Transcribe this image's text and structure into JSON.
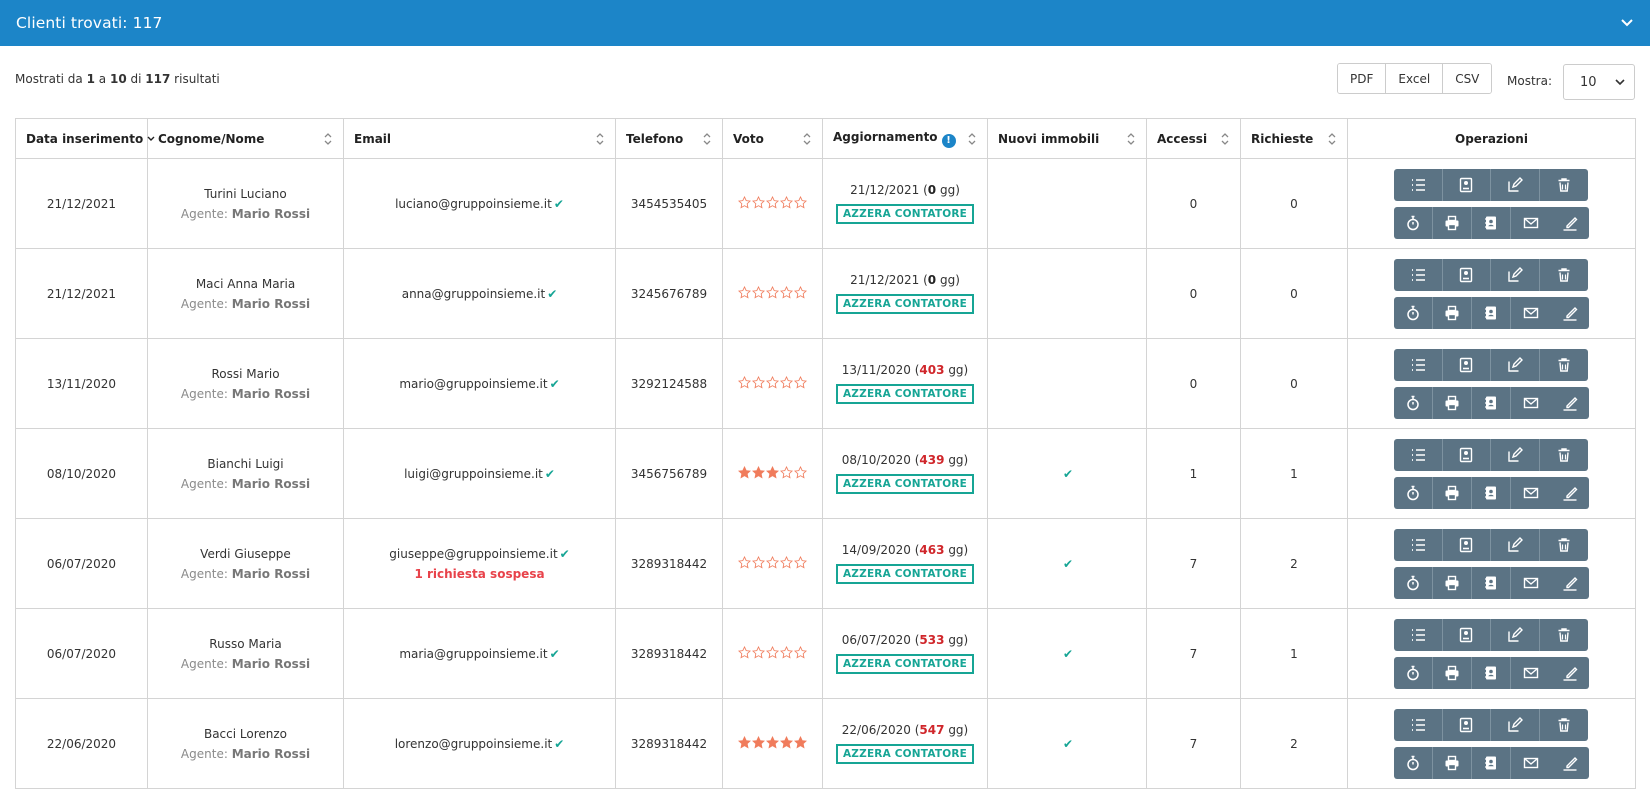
{
  "header": {
    "title": "Clienti trovati: 117"
  },
  "summary": {
    "prefix": "Mostrati da",
    "from": "1",
    "a": "a",
    "to": "10",
    "di": "di",
    "total": "117",
    "suffix": "risultati"
  },
  "exports": [
    "PDF",
    "Excel",
    "CSV"
  ],
  "mostra": {
    "label": "Mostra:",
    "value": "10"
  },
  "columns": [
    "Data inserimento",
    "Cognome/Nome",
    "Email",
    "Telefono",
    "Voto",
    "Aggiornamento",
    "Nuovi immobili",
    "Accessi",
    "Richieste",
    "Operazioni"
  ],
  "agent_label": "Agente:",
  "reset_label": "AZZERA CONTATORE",
  "days_suffix": "gg)",
  "icons": {
    "ops_row1": [
      "list-icon",
      "profile-card-icon",
      "edit-icon",
      "trash-icon"
    ],
    "ops_row2": [
      "stopwatch-icon",
      "print-icon",
      "address-book-icon",
      "mail-icon",
      "signature-icon"
    ]
  },
  "colors": {
    "header_blue": "#1c85c8",
    "teal": "#16a595",
    "star": "#f07c5c",
    "days_red": "#d0262b",
    "button": "#5b7384"
  },
  "rows": [
    {
      "date": "21/12/2021",
      "name": "Turini Luciano",
      "agent": "Mario Rossi",
      "email": "luciano@gruppoinsieme.it",
      "pending": "",
      "phone": "3454535405",
      "rating": 0,
      "upd_date": "21/12/2021 (",
      "upd_days": "0",
      "new_properties": false,
      "accessi": "0",
      "richieste": "0"
    },
    {
      "date": "21/12/2021",
      "name": "Maci Anna Maria",
      "agent": "Mario Rossi",
      "email": "anna@gruppoinsieme.it",
      "pending": "",
      "phone": "3245676789",
      "rating": 0,
      "upd_date": "21/12/2021 (",
      "upd_days": "0",
      "new_properties": false,
      "accessi": "0",
      "richieste": "0"
    },
    {
      "date": "13/11/2020",
      "name": "Rossi Mario",
      "agent": "Mario Rossi",
      "email": "mario@gruppoinsieme.it",
      "pending": "",
      "phone": "3292124588",
      "rating": 0,
      "upd_date": "13/11/2020 (",
      "upd_days": "403",
      "new_properties": false,
      "accessi": "0",
      "richieste": "0"
    },
    {
      "date": "08/10/2020",
      "name": "Bianchi Luigi",
      "agent": "Mario Rossi",
      "email": "luigi@gruppoinsieme.it",
      "pending": "",
      "phone": "3456756789",
      "rating": 3,
      "upd_date": "08/10/2020 (",
      "upd_days": "439",
      "new_properties": true,
      "accessi": "1",
      "richieste": "1"
    },
    {
      "date": "06/07/2020",
      "name": "Verdi Giuseppe",
      "agent": "Mario Rossi",
      "email": "giuseppe@gruppoinsieme.it",
      "pending": "1 richiesta sospesa",
      "phone": "3289318442",
      "rating": 0,
      "upd_date": "14/09/2020 (",
      "upd_days": "463",
      "new_properties": true,
      "accessi": "7",
      "richieste": "2"
    },
    {
      "date": "06/07/2020",
      "name": "Russo Maria",
      "agent": "Mario Rossi",
      "email": "maria@gruppoinsieme.it",
      "pending": "",
      "phone": "3289318442",
      "rating": 0,
      "upd_date": "06/07/2020 (",
      "upd_days": "533",
      "new_properties": true,
      "accessi": "7",
      "richieste": "1"
    },
    {
      "date": "22/06/2020",
      "name": "Bacci Lorenzo",
      "agent": "Mario Rossi",
      "email": "lorenzo@gruppoinsieme.it",
      "pending": "",
      "phone": "3289318442",
      "rating": 5,
      "upd_date": "22/06/2020 (",
      "upd_days": "547",
      "new_properties": true,
      "accessi": "7",
      "richieste": "2"
    }
  ]
}
